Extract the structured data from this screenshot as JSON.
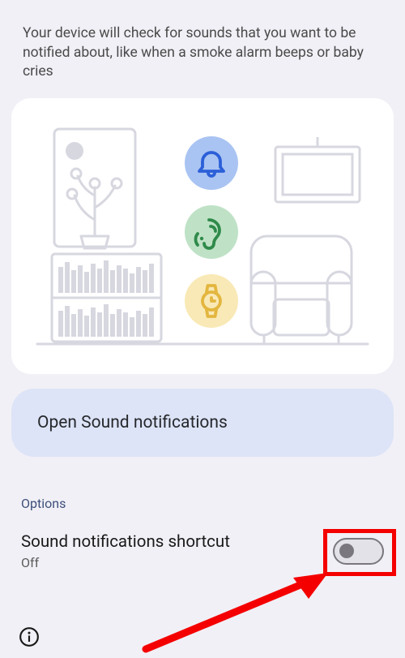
{
  "description": "Your device will check for sounds that you want to be notified about, like when a smoke alarm beeps or baby cries",
  "open_button": {
    "label": "Open Sound notifications"
  },
  "options_label": "Options",
  "shortcut": {
    "title": "Sound notifications shortcut",
    "state": "Off",
    "enabled": false
  },
  "icons": {
    "bell": "bell-icon",
    "ear": "ear-icon",
    "watch": "watch-icon",
    "info": "info-icon"
  },
  "colors": {
    "bell_bg": "#a9c4f2",
    "bell_fg": "#2c5fd8",
    "ear_bg": "#bfe2c6",
    "ear_fg": "#2f8a4a",
    "watch_bg": "#f9e9b6",
    "watch_fg": "#e3b63f",
    "button_bg": "#dde4f7",
    "accent_red": "#f40000"
  }
}
